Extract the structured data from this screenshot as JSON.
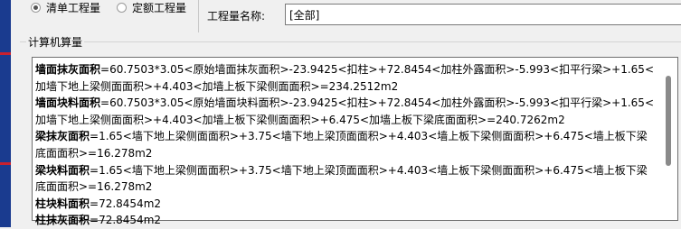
{
  "options": {
    "qingdan_label": "清单工程量",
    "dinge_label": "定额工程量",
    "selected": "qingdan"
  },
  "filter": {
    "name_label": "工程量名称:",
    "name_value": "[全部]"
  },
  "calc": {
    "group_title": "计算机算量",
    "entries": [
      {
        "key": "墙面抹灰面积",
        "text": "=60.7503*3.05<原始墙面抹灰面积>-23.9425<扣柱>+72.8454<加柱外露面积>-5.993<扣平行梁>+1.65<加墙下地上梁侧面面积>+4.403<加墙上板下梁侧面面积>=234.2512m2"
      },
      {
        "key": "墙面块料面积",
        "text": "=60.7503*3.05<原始墙面块料面积>-23.9425<扣柱>+72.8454<加柱外露面积>-5.993<扣平行梁>+1.65<加墙下地上梁侧面面积>+4.403<加墙上板下梁侧面面积>+6.475<加墙上板下梁底面面积>=240.7262m2"
      },
      {
        "key": "梁抹灰面积",
        "text": "=1.65<墙下地上梁侧面面积>+3.75<墙下地上梁顶面面积>+4.403<墙上板下梁侧面面积>+6.475<墙上板下梁底面面积>=16.278m2"
      },
      {
        "key": "梁块料面积",
        "text": "=1.65<墙下地上梁侧面面积>+3.75<墙下地上梁顶面面积>+4.403<墙上板下梁侧面面积>+6.475<墙上板下梁底面面积>=16.278m2"
      },
      {
        "key": "柱块料面积",
        "text": "=72.8454m2"
      },
      {
        "key": "柱抹灰面积",
        "text": "=72.8454m2"
      }
    ]
  }
}
